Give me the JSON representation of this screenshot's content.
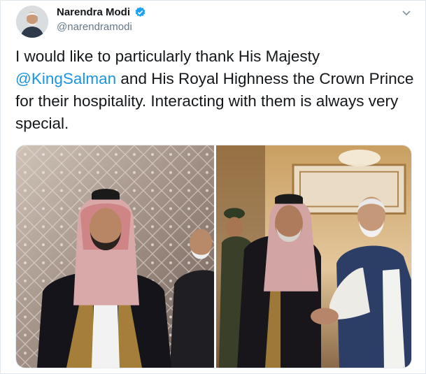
{
  "tweet": {
    "author_name": "Narendra Modi",
    "handle": "@narendramodi",
    "text_before": "I would like to particularly thank His Majesty ",
    "mention": "@KingSalman",
    "text_after": " and His Royal Highness the Crown Prince for their hospitality. Interacting with them is always very special."
  },
  "icons": {
    "verified": "verified-badge-icon",
    "caret": "chevron-down-icon"
  },
  "colors": {
    "link": "#1b95e0",
    "verified": "#1da1f2",
    "secondary_text": "#657786"
  }
}
